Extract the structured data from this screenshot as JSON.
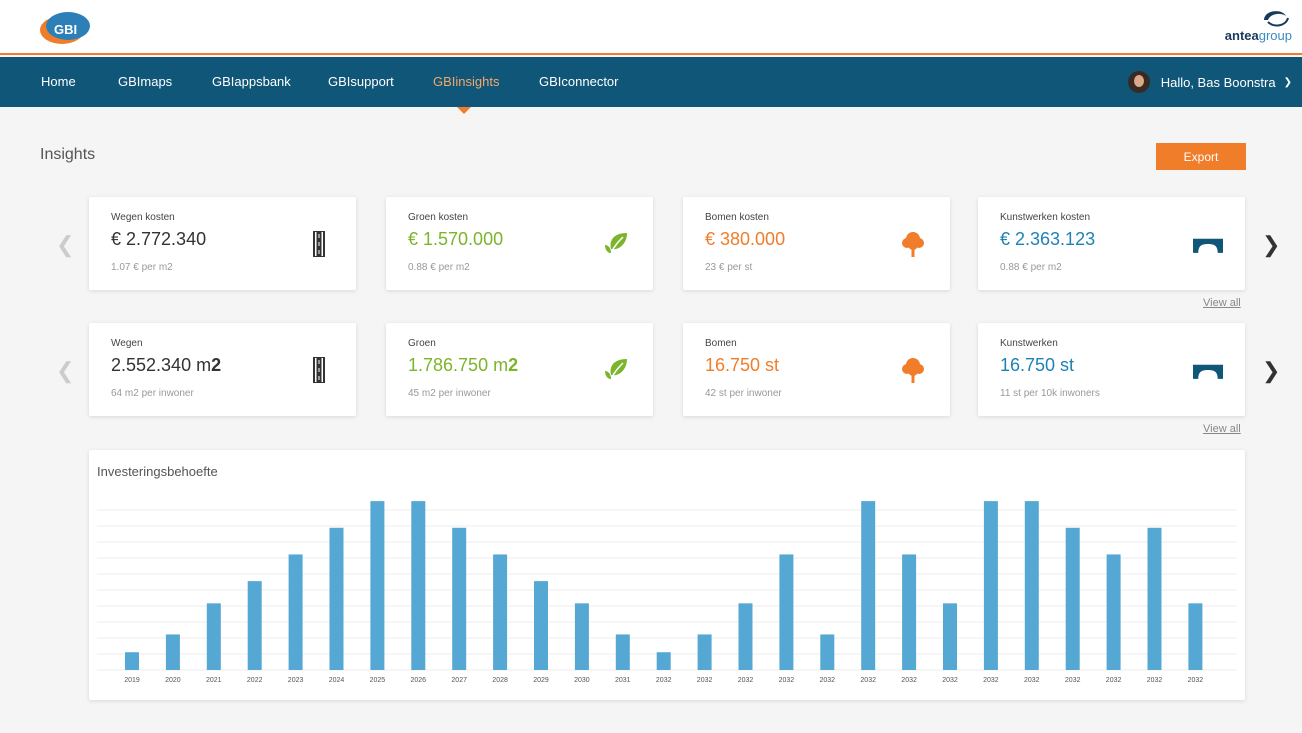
{
  "colors": {
    "navy": "#0f5678",
    "orange": "#f07d2a",
    "green": "#7cb42b",
    "blue": "#1f82b5",
    "bar": "#55a8d4"
  },
  "logos": {
    "gbi": "GBI",
    "antea_bold": "antea",
    "antea_light": "group"
  },
  "nav": {
    "items": [
      "Home",
      "GBImaps",
      "GBIappsbank",
      "GBIsupport",
      "GBIinsights",
      "GBIconnector"
    ],
    "active": "GBIinsights",
    "user_greeting": "Hallo, Bas Boonstra"
  },
  "page": {
    "title": "Insights",
    "export_label": "Export",
    "view_all": "View all"
  },
  "cost_cards": [
    {
      "label": "Wegen kosten",
      "value": "€ 2.772.340",
      "sub": "1.07 € per m2",
      "color": "#333333",
      "icon": "road-icon"
    },
    {
      "label": "Groen kosten",
      "value": "€ 1.570.000",
      "sub": "0.88 € per m2",
      "color": "#7cb42b",
      "icon": "leaf-icon"
    },
    {
      "label": "Bomen kosten",
      "value": "€ 380.000",
      "sub": "23 € per st",
      "color": "#f07d2a",
      "icon": "tree-icon"
    },
    {
      "label": "Kunstwerken kosten",
      "value": "€ 2.363.123",
      "sub": "0.88 € per m2",
      "color": "#1f82b5",
      "icon": "bridge-icon"
    }
  ],
  "quantity_cards": [
    {
      "label": "Wegen",
      "value_main": "2.552.340 m",
      "value_bold": "2",
      "sub": "64 m2 per inwoner",
      "color": "#333333",
      "icon": "road-icon"
    },
    {
      "label": "Groen",
      "value_main": "1.786.750 m",
      "value_bold": "2",
      "sub": "45 m2 per inwoner",
      "color": "#7cb42b",
      "icon": "leaf-icon"
    },
    {
      "label": "Bomen",
      "value_main": "16.750 st",
      "value_bold": "",
      "sub": "42 st per inwoner",
      "color": "#f07d2a",
      "icon": "tree-icon"
    },
    {
      "label": "Kunstwerken",
      "value_main": "16.750 st",
      "value_bold": "",
      "sub": "11 st per 10k inwoners",
      "color": "#1f82b5",
      "icon": "bridge-icon"
    }
  ],
  "chart_data": {
    "type": "bar",
    "title": "Investeringsbehoefte",
    "xlabel": "",
    "ylabel": "",
    "grid": true,
    "ylim": [
      0,
      18
    ],
    "categories": [
      "2019",
      "2020",
      "2021",
      "2022",
      "2023",
      "2024",
      "2025",
      "2026",
      "2027",
      "2028",
      "2029",
      "2030",
      "2031",
      "2032",
      "2032",
      "2032",
      "2032",
      "2032",
      "2032",
      "2032",
      "2032",
      "2032",
      "2032",
      "2032",
      "2032",
      "2032",
      "2032"
    ],
    "values": [
      2,
      4,
      7.5,
      10,
      13,
      16,
      19,
      19,
      16,
      13,
      10,
      7.5,
      4,
      2,
      4,
      7.5,
      13,
      4,
      19,
      13,
      7.5,
      19,
      19,
      16,
      13,
      16,
      7.5
    ]
  }
}
